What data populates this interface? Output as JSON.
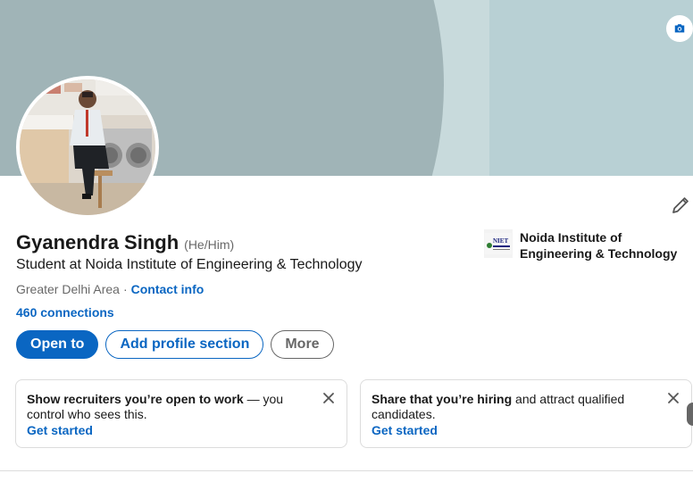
{
  "profile": {
    "name": "Gyanendra Singh",
    "pronouns": "(He/Him)",
    "headline": "Student at Noida Institute of Engineering & Technology",
    "location": "Greater Delhi Area",
    "separator": "·",
    "contact_label": "Contact info",
    "connections": "460 connections"
  },
  "school": {
    "name": "Noida Institute of Engineering & Technology",
    "logo_text": "NIET"
  },
  "actions": {
    "open_to": "Open to",
    "add_section": "Add profile section",
    "more": "More"
  },
  "cards": [
    {
      "bold": "Show recruiters you’re open to work",
      "rest": " — you control who sees this.",
      "link": "Get started"
    },
    {
      "bold": "Share that you’re hiring",
      "rest": " and attract qualified candidates.",
      "link": "Get started"
    }
  ],
  "icons": {
    "camera": "camera-icon",
    "edit": "pencil-icon",
    "close": "close-icon"
  },
  "colors": {
    "brand_blue": "#0a66c2",
    "banner_dark": "#a0b4b7",
    "banner_light": "#c8dadc",
    "banner_right": "#b8d0d4"
  }
}
